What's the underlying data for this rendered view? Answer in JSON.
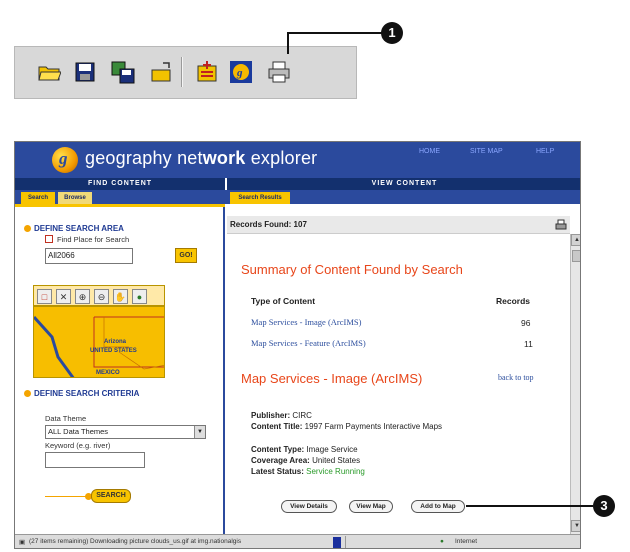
{
  "toolbar": {
    "icons": [
      "open-folder-icon",
      "save-icon",
      "save-as-icon",
      "open-layer-icon",
      "add-data-icon",
      "geography-network-icon",
      "print-icon"
    ],
    "callout_1": "1"
  },
  "browser": {
    "brand_prefix": "geography net",
    "brand_bold": "work",
    "brand_suffix": " explorer",
    "links": {
      "home": "HOME",
      "site_map": "SITE MAP",
      "help": "HELP"
    },
    "find_content": "FIND CONTENT",
    "view_content": "VIEW CONTENT",
    "tabs": {
      "search": "Search",
      "browse": "Browse",
      "search_results": "Search Results"
    }
  },
  "left": {
    "define_search_area": "DEFINE SEARCH AREA",
    "find_place_label": "Find Place for Search",
    "place_value": "All2066",
    "go_label": "GO!",
    "map_labels": {
      "arizona": "Arizona",
      "us": "UNITED STATES",
      "mexico": "MEXICO"
    },
    "define_search_criteria": "DEFINE SEARCH CRITERIA",
    "data_theme_label": "Data Theme",
    "data_theme_value": "ALL Data Themes",
    "keyword_label": "Keyword (e.g. river)",
    "keyword_value": "",
    "search_button": "SEARCH"
  },
  "right": {
    "records_found": "Records Found: 107",
    "summary_title": "Summary of Content Found by Search",
    "type_header": "Type of Content",
    "records_header": "Records",
    "rows": [
      {
        "label": "Map Services - Image (ArcIMS)",
        "count": "96"
      },
      {
        "label": "Map Services - Feature (ArcIMS)",
        "count": "11"
      }
    ],
    "section_title": "Map Services - Image (ArcIMS)",
    "back_to_top": "back to top",
    "publisher_label": "Publisher:",
    "publisher_value": "CIRC",
    "content_title_label": "Content Title:",
    "content_title_value": "1997 Farm Payments Interactive Maps",
    "content_type_label": "Content Type:",
    "content_type_value": "Image Service",
    "coverage_label": "Coverage Area:",
    "coverage_value": "United States",
    "status_label": "Latest Status:",
    "status_value": "Service Running",
    "buttons": {
      "view_details": "View Details",
      "view_map": "View Map",
      "add_to_map": "Add to Map"
    }
  },
  "statusbar": {
    "text": "(27 items remaining) Downloading picture clouds_us.gif at img.nationalgis",
    "zone": "Internet"
  },
  "callout_3": "3",
  "colors": {
    "navy": "#2b4a9d",
    "gold": "#f8c400",
    "red_title": "#e8461a",
    "link_blue": "#2d4f9e",
    "status_green": "#2a9a2a"
  }
}
